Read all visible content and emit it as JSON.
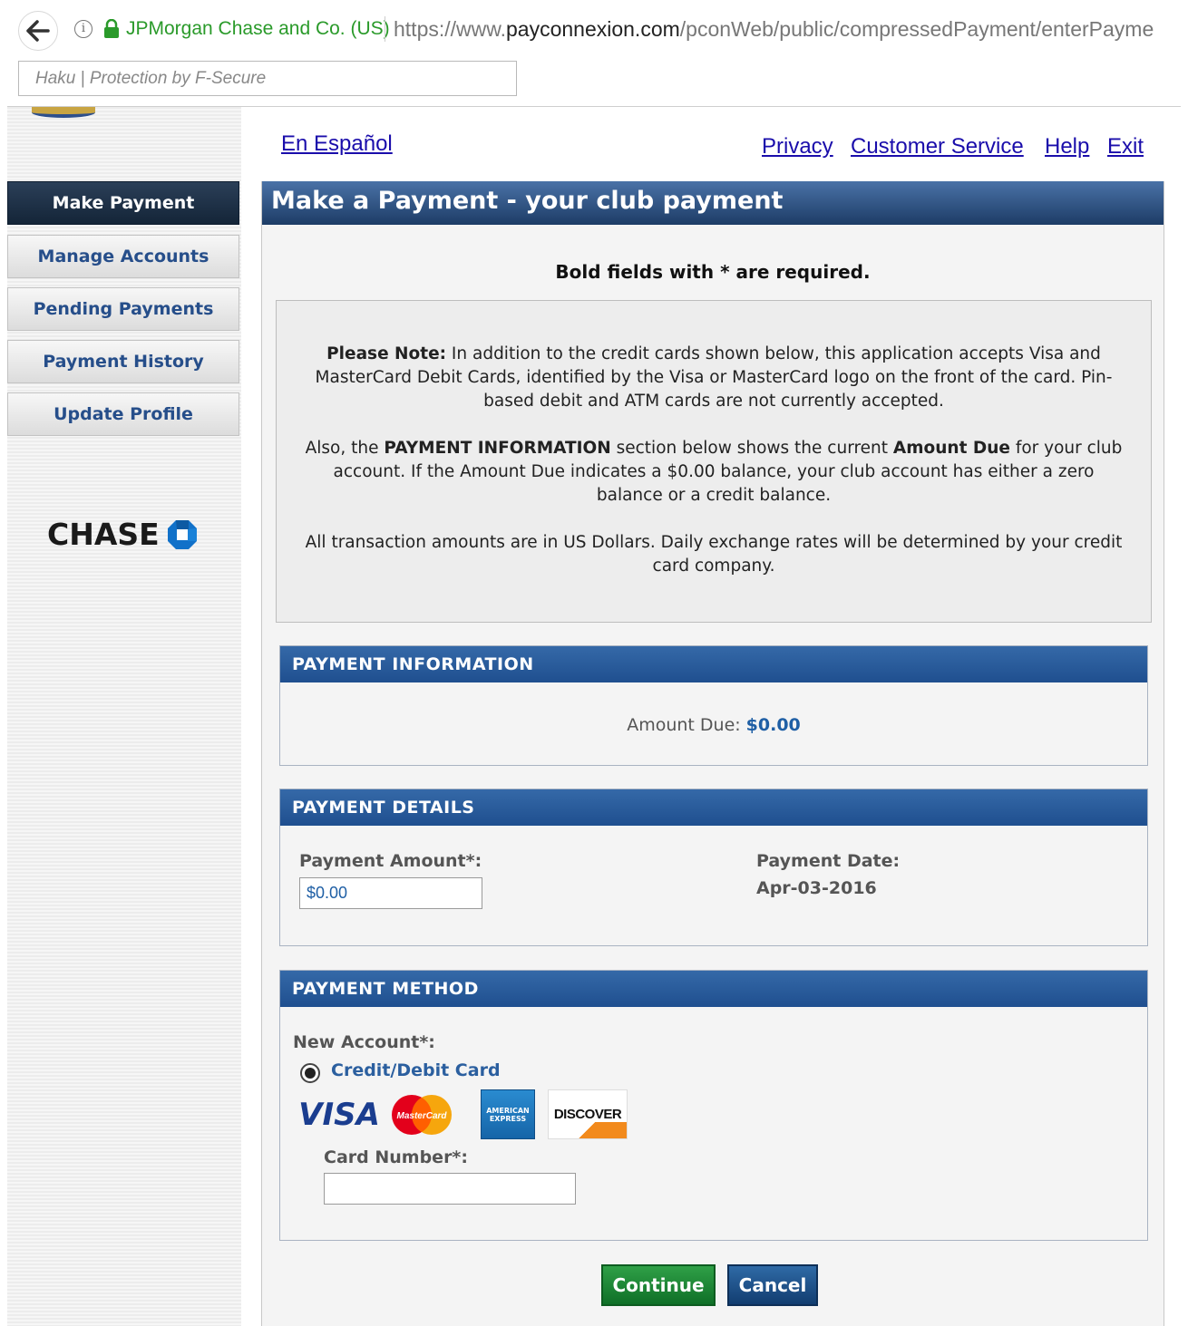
{
  "browser": {
    "ev_name": "JPMorgan Chase and Co. (US)",
    "url_prefix": "https://www.",
    "url_domain": "payconnexion.com",
    "url_path": "/pconWeb/public/compressedPayment/enterPayme",
    "extension_text": "Haku | Protection by F-Secure"
  },
  "top_links": {
    "espanol": "En Español",
    "privacy": "Privacy",
    "customer_service": "Customer Service",
    "help": "Help",
    "exit": "Exit"
  },
  "sidebar": {
    "items": [
      {
        "label": "Make Payment",
        "active": true
      },
      {
        "label": "Manage Accounts"
      },
      {
        "label": "Pending Payments"
      },
      {
        "label": "Payment History"
      },
      {
        "label": "Update Profile"
      }
    ],
    "logo_text": "CHASE"
  },
  "main": {
    "title": "Make a Payment - your club payment",
    "required_note": "Bold fields with * are required.",
    "note": {
      "p1_bold": "Please Note:",
      "p1_text": " In addition to the credit cards shown below, this application accepts Visa and MasterCard Debit Cards, identified by the Visa or MasterCard logo on the front of the card. Pin-based debit and ATM cards are not currently accepted.",
      "p2_a": "Also, the ",
      "p2_b": "PAYMENT INFORMATION",
      "p2_c": " section below shows the current ",
      "p2_d": "Amount Due",
      "p2_e": " for your club account. If the Amount Due indicates a $0.00 balance, your club account has either a zero balance or a credit balance.",
      "p3": "All transaction amounts are in US Dollars. Daily exchange rates will be determined by your credit card company."
    },
    "payment_information": {
      "heading": "PAYMENT INFORMATION",
      "amount_due_label": "Amount Due:",
      "amount_due_value": "$0.00"
    },
    "payment_details": {
      "heading": "PAYMENT DETAILS",
      "amount_label": "Payment Amount*:",
      "amount_value": "$0.00",
      "date_label": "Payment Date:",
      "date_value": "Apr-03-2016"
    },
    "payment_method": {
      "heading": "PAYMENT METHOD",
      "new_account_label": "New Account*:",
      "option_label": "Credit/Debit Card",
      "cards": [
        "VISA",
        "MasterCard",
        "AMERICAN EXPRESS",
        "DISCOVER"
      ],
      "card_number_label": "Card Number*:",
      "card_number_value": ""
    },
    "buttons": {
      "continue": "Continue",
      "cancel": "Cancel"
    }
  },
  "colors": {
    "nav_active": "#1c2f47",
    "header_blue": "#1f4f8f",
    "link_blue": "#1a0dab",
    "continue_green": "#1a8a35"
  }
}
